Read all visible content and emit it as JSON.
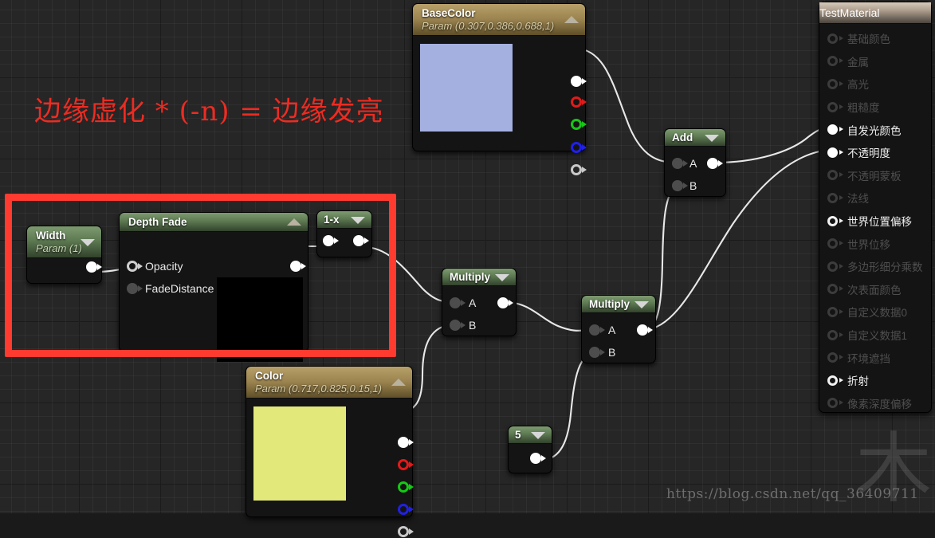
{
  "annotation": {
    "text": "边缘虚化 * (-n) = 边缘发亮",
    "color": "#ee2b21"
  },
  "watermark": {
    "url": "https://blog.csdn.net/qq_36409711",
    "glyph": "木"
  },
  "nodes": {
    "basecolor": {
      "title": "BaseColor",
      "subtitle": "Param (0.307,0.386,0.688,1)",
      "swatch": "#a4b0e0",
      "outputs": [
        "rgba",
        "r",
        "g",
        "b",
        "a"
      ]
    },
    "color": {
      "title": "Color",
      "subtitle": "Param (0.717,0.825,0.15,1)",
      "swatch": "#e2e87a",
      "outputs": [
        "rgba",
        "r",
        "g",
        "b",
        "a"
      ]
    },
    "width": {
      "title": "Width",
      "subtitle": "Param (1)"
    },
    "depthfade": {
      "title": "Depth Fade",
      "inputs": [
        "Opacity",
        "FadeDistance"
      ],
      "preview_color": "#000000"
    },
    "oneminusx": {
      "title": "1-x"
    },
    "multiply1": {
      "title": "Multiply",
      "inputs": [
        "A",
        "B"
      ]
    },
    "multiply2": {
      "title": "Multiply",
      "inputs": [
        "A",
        "B"
      ]
    },
    "add": {
      "title": "Add",
      "inputs": [
        "A",
        "B"
      ]
    },
    "constant5": {
      "title": "5"
    }
  },
  "material": {
    "title": "TestMaterial",
    "pins": [
      {
        "label": "基础颜色",
        "state": "off"
      },
      {
        "label": "金属",
        "state": "off"
      },
      {
        "label": "高光",
        "state": "off"
      },
      {
        "label": "粗糙度",
        "state": "off"
      },
      {
        "label": "自发光颜色",
        "state": "on"
      },
      {
        "label": "不透明度",
        "state": "on"
      },
      {
        "label": "不透明蒙板",
        "state": "off"
      },
      {
        "label": "法线",
        "state": "off"
      },
      {
        "label": "世界位置偏移",
        "state": "ring"
      },
      {
        "label": "世界位移",
        "state": "off"
      },
      {
        "label": "多边形细分乘数",
        "state": "off"
      },
      {
        "label": "次表面颜色",
        "state": "off"
      },
      {
        "label": "自定义数据0",
        "state": "off"
      },
      {
        "label": "自定义数据1",
        "state": "off"
      },
      {
        "label": "环境遮挡",
        "state": "off"
      },
      {
        "label": "折射",
        "state": "ring"
      },
      {
        "label": "像素深度偏移",
        "state": "off"
      }
    ]
  }
}
